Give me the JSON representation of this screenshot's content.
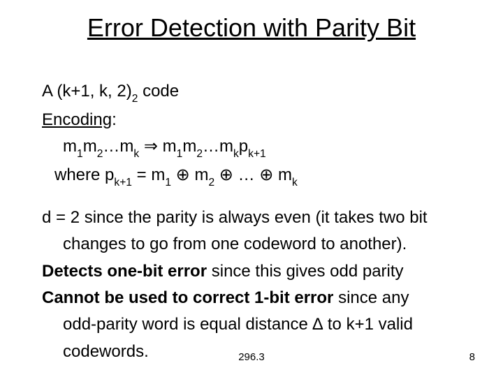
{
  "title": "Error Detection with Parity Bit",
  "body": {
    "line1_pre": "A (k+1, k, 2)",
    "line1_sub": "2",
    "line1_post": " code",
    "encoding_label": "Encoding",
    "colon": ":",
    "map_m": "m",
    "map_1": "1",
    "map_2": "2",
    "map_dots": "…",
    "map_k": "k",
    "map_arrow": " ⇒ ",
    "map_p": "p",
    "map_kplus1": "k+1",
    "where_pre": "where p",
    "where_eq": " = m",
    "where_xor": " ⊕ ",
    "where_mid": "m",
    "where_dots": " … ",
    "where_end": "m",
    "d2_a": "d = 2 since the parity is always even (it takes two bit",
    "d2_b": "changes to go from one codeword to another).",
    "detects_b": "Detects one-bit error",
    "detects_rest": " since this gives odd parity",
    "cannot_b": "Cannot be used to correct 1-bit error",
    "cannot_rest_a": " since any",
    "cannot_rest_b": "odd-parity word is equal distance ∆ to k+1 valid",
    "cannot_rest_c": "codewords."
  },
  "footer": {
    "center": "296.3",
    "page": "8"
  }
}
